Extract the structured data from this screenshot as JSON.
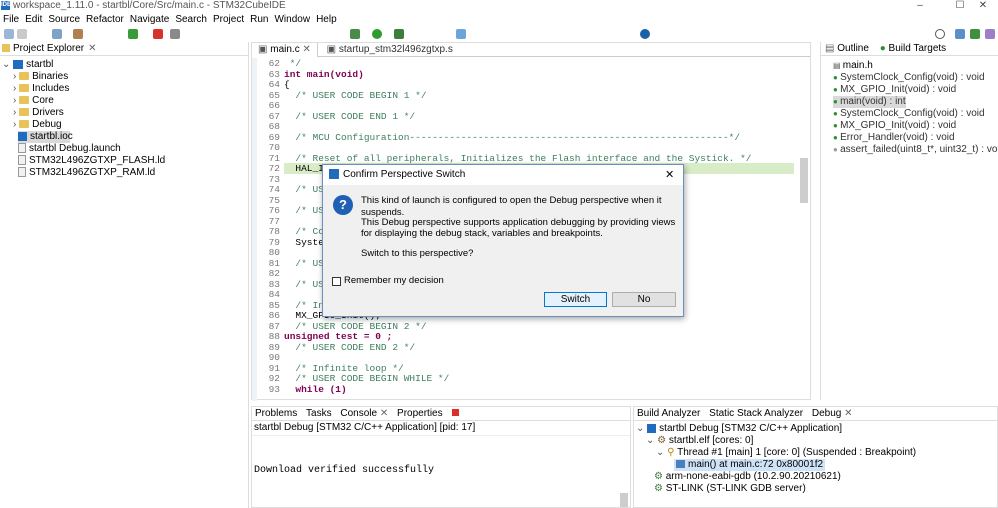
{
  "window": {
    "title": "workspace_1.11.0 - startbl/Core/Src/main.c - STM32CubeIDE",
    "app_icon": "IDE",
    "minimize": "–",
    "maximize": "☐",
    "close": "✕"
  },
  "menu": [
    "File",
    "Edit",
    "Source",
    "Refactor",
    "Navigate",
    "Search",
    "Project",
    "Run",
    "Window",
    "Help"
  ],
  "project_explorer": {
    "tab_label": "Project Explorer",
    "root": "startbl",
    "items": [
      "Binaries",
      "Includes",
      "Core",
      "Drivers",
      "Debug",
      "startbl.ioc",
      "startbl Debug.launch",
      "STM32L496ZGTXP_FLASH.ld",
      "STM32L496ZGTXP_RAM.ld"
    ]
  },
  "editor": {
    "tabs": [
      "main.c",
      "startup_stm32l496zgtxp.s"
    ],
    "lines": [
      {
        "n": "62",
        "t": " */"
      },
      {
        "n": "63",
        "t": "int main(void)"
      },
      {
        "n": "64",
        "t": "{"
      },
      {
        "n": "65",
        "t": "  /* USER CODE BEGIN 1 */"
      },
      {
        "n": "66",
        "t": ""
      },
      {
        "n": "67",
        "t": "  /* USER CODE END 1 */"
      },
      {
        "n": "68",
        "t": ""
      },
      {
        "n": "69",
        "t": "  /* MCU Configuration--------------------------------------------------------*/"
      },
      {
        "n": "70",
        "t": ""
      },
      {
        "n": "71",
        "t": "  /* Reset of all peripherals, Initializes the Flash interface and the Systick. */"
      },
      {
        "n": "72",
        "t": "  HAL_Init();"
      },
      {
        "n": "73",
        "t": ""
      },
      {
        "n": "74",
        "t": "  /* USER"
      },
      {
        "n": "75",
        "t": ""
      },
      {
        "n": "76",
        "t": "  /* USER"
      },
      {
        "n": "77",
        "t": ""
      },
      {
        "n": "78",
        "t": "  /* Conf"
      },
      {
        "n": "79",
        "t": "  SystemC"
      },
      {
        "n": "80",
        "t": ""
      },
      {
        "n": "81",
        "t": "  /* USER"
      },
      {
        "n": "82",
        "t": ""
      },
      {
        "n": "83",
        "t": "  /* USER"
      },
      {
        "n": "84",
        "t": ""
      },
      {
        "n": "85",
        "t": "  /* Init"
      },
      {
        "n": "86",
        "t": "  MX_GPIO_Init();"
      },
      {
        "n": "87",
        "t": "  /* USER CODE BEGIN 2 */"
      },
      {
        "n": "88",
        "t": "unsigned test = 0 ;"
      },
      {
        "n": "89",
        "t": "  /* USER CODE END 2 */"
      },
      {
        "n": "90",
        "t": ""
      },
      {
        "n": "91",
        "t": "  /* Infinite loop */"
      },
      {
        "n": "92",
        "t": "  /* USER CODE BEGIN WHILE */"
      },
      {
        "n": "93",
        "t": "  while (1)"
      }
    ]
  },
  "outline": {
    "tabs": [
      "Outline",
      "Build Targets"
    ],
    "items": [
      "main.h",
      "SystemClock_Config(void) : void",
      "MX_GPIO_Init(void) : void",
      "main(void) : int",
      "SystemClock_Config(void) : void",
      "MX_GPIO_Init(void) : void",
      "Error_Handler(void) : void",
      "assert_failed(uint8_t*, uint32_t) : void"
    ]
  },
  "console": {
    "tabs": [
      "Problems",
      "Tasks",
      "Console",
      "Properties"
    ],
    "header": "startbl Debug [STM32 C/C++ Application]  [pid: 17]",
    "output": "Download verified successfully"
  },
  "debug": {
    "tabs": [
      "Build Analyzer",
      "Static Stack Analyzer",
      "Debug"
    ],
    "items": [
      "startbl Debug [STM32 C/C++ Application]",
      "startbl.elf [cores: 0]",
      "Thread #1 [main] 1 [core: 0] (Suspended : Breakpoint)",
      "main() at main.c:72 0x80001f2",
      "arm-none-eabi-gdb (10.2.90.20210621)",
      "ST-LINK (ST-LINK GDB server)"
    ]
  },
  "dialog": {
    "title": "Confirm Perspective Switch",
    "msg1": "This kind of launch is configured to open the Debug perspective when it suspends.",
    "msg2": "This Debug perspective supports application debugging by providing views for displaying the debug stack, variables and breakpoints.",
    "msg3": "Switch to this perspective?",
    "checkbox": "Remember my decision",
    "yes": "Switch",
    "no": "No",
    "close": "✕",
    "question": "?"
  }
}
